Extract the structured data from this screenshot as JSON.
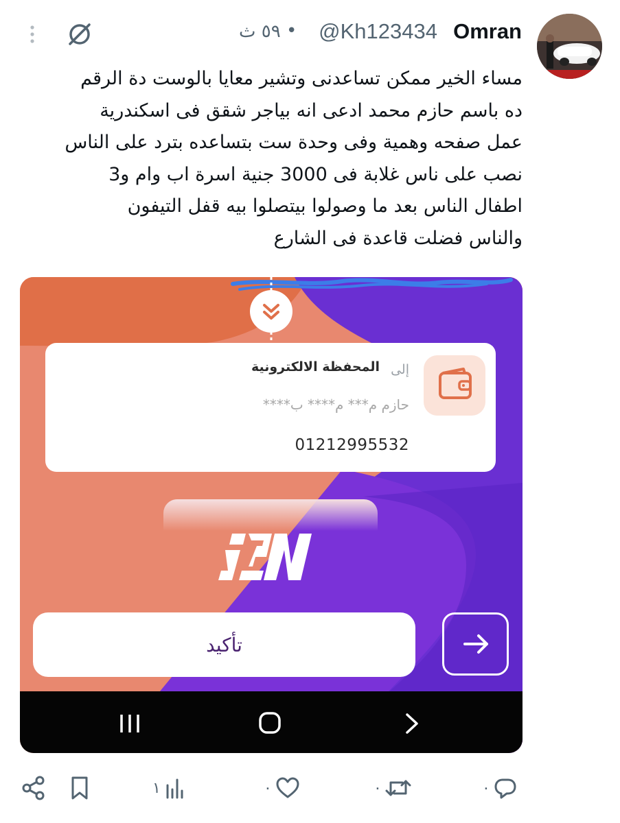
{
  "header": {
    "name": "Omran",
    "handle": "@Kh123434",
    "separator": "•",
    "time": "٥٩ ث",
    "icons": [
      "grok-icon",
      "more-vertical-icon"
    ]
  },
  "tweet": {
    "text": "مساء الخير ممكن تساعدنى وتشير معايا بالوست دة  الرقم\nده باسم حازم محمد  ادعى انه بياجر شقق فى اسكندرية\nعمل صفحه وهمية وفى وحدة ست بتساعده بترد على الناس\nنصب على ناس غلابة فى 3000 جنية اسرة اب وام و3\nاطفال الناس بعد ما وصولوا بيتصلوا بيه قفل التيفون\nوالناس فضلت قاعدة فى الشارع"
  },
  "media": {
    "to_label": "إلى",
    "wallet_label": "المحفظة الالكترونية",
    "masked_name": "حازم م*** م**** ب****",
    "phone_number": "01212995532",
    "confirm_label": "تأكيد",
    "colors": {
      "orange": "#e0704a",
      "salmon": "#e8886f",
      "purple": "#6b2fd6",
      "deep_purple": "#4a1fb8",
      "scribble": "#3c7de8"
    },
    "icons": [
      "chevron-double-down-icon",
      "wallet-icon",
      "ipn-logo",
      "arrow-right-icon",
      "recents-icon",
      "home-icon",
      "back-icon"
    ]
  },
  "actions": {
    "reply_count": "٠",
    "retweet_count": "٠",
    "like_count": "٠",
    "views_count": "١",
    "icons": [
      "reply-icon",
      "retweet-icon",
      "like-icon",
      "views-icon",
      "bookmark-icon",
      "share-icon"
    ]
  }
}
